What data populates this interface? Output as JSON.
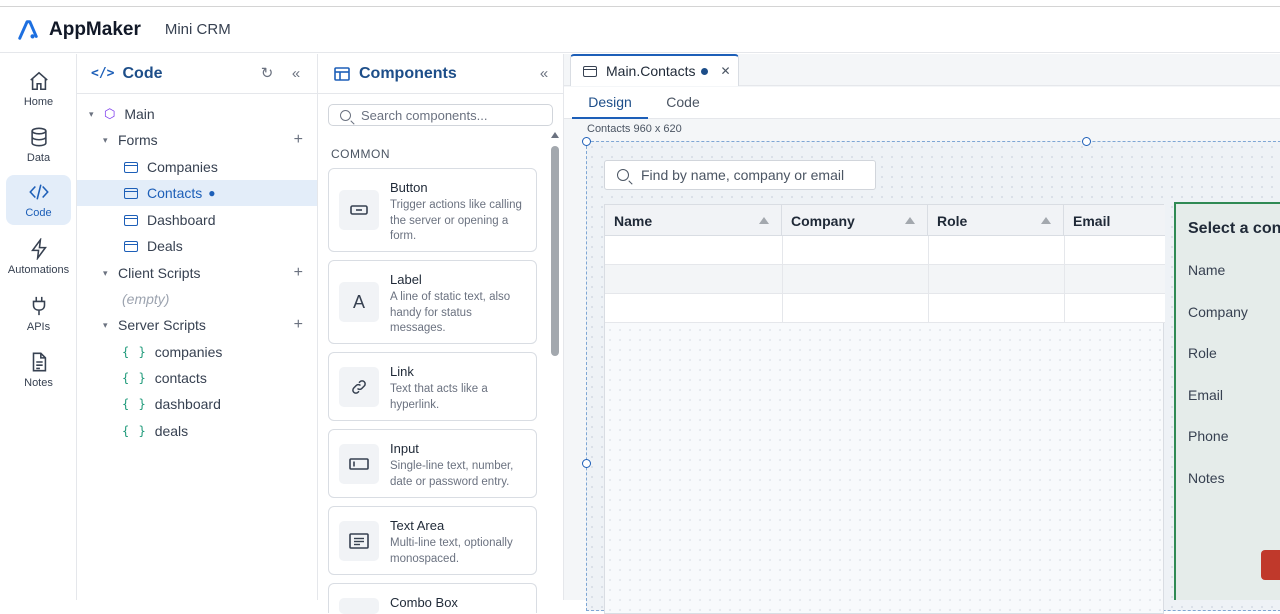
{
  "app": {
    "brand": "AppMaker",
    "project": "Mini CRM"
  },
  "rail": [
    {
      "label": "Home",
      "icon": "home-icon"
    },
    {
      "label": "Data",
      "icon": "database-icon"
    },
    {
      "label": "Code",
      "icon": "code-icon",
      "active": true
    },
    {
      "label": "Automations",
      "icon": "lightning-icon"
    },
    {
      "label": "APIs",
      "icon": "plug-icon"
    },
    {
      "label": "Notes",
      "icon": "document-icon"
    }
  ],
  "code_panel": {
    "title": "Code",
    "root": "Main",
    "forms_label": "Forms",
    "forms": [
      "Companies",
      "Contacts",
      "Dashboard",
      "Deals"
    ],
    "selected_form": "Contacts",
    "client_scripts_label": "Client Scripts",
    "client_scripts_empty": "(empty)",
    "server_scripts_label": "Server Scripts",
    "server_scripts": [
      "companies",
      "contacts",
      "dashboard",
      "deals"
    ]
  },
  "components_panel": {
    "title": "Components",
    "search_placeholder": "Search components...",
    "section": "COMMON",
    "items": [
      {
        "name": "Button",
        "desc": "Trigger actions like calling the server or opening a form.",
        "icon": "button-icon"
      },
      {
        "name": "Label",
        "desc": "A line of static text, also handy for status messages.",
        "icon": "label-icon"
      },
      {
        "name": "Link",
        "desc": "Text that acts like a hyperlink.",
        "icon": "link-icon"
      },
      {
        "name": "Input",
        "desc": "Single-line text, number, date or password entry.",
        "icon": "input-icon"
      },
      {
        "name": "Text Area",
        "desc": "Multi-line text, optionally monospaced.",
        "icon": "textarea-icon"
      },
      {
        "name": "Combo Box",
        "desc": "",
        "icon": "combobox-icon"
      }
    ]
  },
  "editor": {
    "tab_label": "Main.Contacts",
    "subtabs": [
      "Design",
      "Code"
    ],
    "active_subtab": "Design",
    "form_dims": "Contacts 960 x 620",
    "search_placeholder": "Find by name, company or email",
    "grid_columns": [
      "Name",
      "Company",
      "Role",
      "Email"
    ],
    "detail_title": "Select a contact",
    "detail_fields": [
      "Name",
      "Company",
      "Role",
      "Email",
      "Phone",
      "Notes"
    ]
  },
  "colors": {
    "accent": "#1d5fb8",
    "selection": "#e3edf9",
    "detail_border": "#2f8a54",
    "danger": "#c0392b"
  }
}
